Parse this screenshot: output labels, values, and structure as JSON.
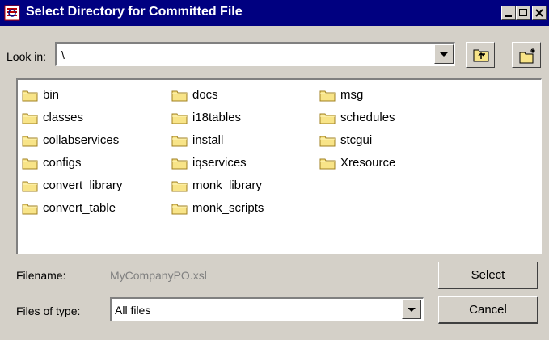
{
  "window": {
    "title": "Select Directory for Committed File",
    "icons": [
      "app-icon",
      "minimize-icon",
      "maximize-icon",
      "close-icon"
    ]
  },
  "look_in": {
    "label": "Look in:",
    "value": "\\",
    "icons": [
      "chevron-down-icon",
      "up-folder-icon",
      "new-folder-icon"
    ]
  },
  "files": {
    "columns": [
      [
        "bin",
        "classes",
        "collabservices",
        "configs",
        "convert_library",
        "convert_table"
      ],
      [
        "docs",
        "i18tables",
        "install",
        "iqservices",
        "monk_library",
        "monk_scripts"
      ],
      [
        "msg",
        "schedules",
        "stcgui",
        "Xresource"
      ]
    ],
    "item_icon": "folder-icon"
  },
  "filename": {
    "label": "Filename:",
    "value": "MyCompanyPO.xsl"
  },
  "file_type": {
    "label": "Files of type:",
    "value": "All files"
  },
  "buttons": {
    "select": "Select",
    "cancel": "Cancel"
  },
  "colors": {
    "titlebar": "#000080",
    "dialog_bg": "#d4d0c8",
    "folder": "#f8e488"
  }
}
